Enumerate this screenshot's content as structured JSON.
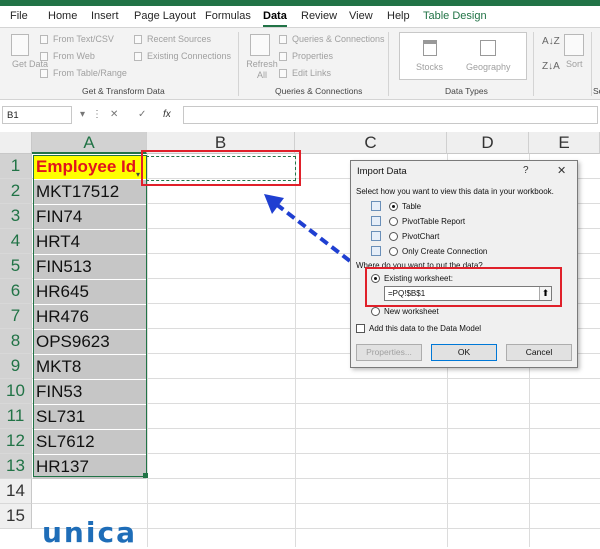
{
  "tabs": [
    "File",
    "Home",
    "Insert",
    "Page Layout",
    "Formulas",
    "Data",
    "Review",
    "View",
    "Help",
    "Table Design"
  ],
  "ribbon": {
    "get_data": "Get Data",
    "from_text_csv": "From Text/CSV",
    "from_web": "From Web",
    "from_table_range": "From Table/Range",
    "recent_sources": "Recent Sources",
    "existing_connections": "Existing Connections",
    "group_get_transform": "Get & Transform Data",
    "refresh_all": "Refresh All",
    "queries_connections": "Queries & Connections",
    "properties": "Properties",
    "edit_links": "Edit Links",
    "group_queries": "Queries & Connections",
    "stocks": "Stocks",
    "geography": "Geography",
    "group_data_types": "Data Types",
    "sort": "Sort",
    "group_partial": "So"
  },
  "formula_bar": {
    "name_box": "B1",
    "fx": "fx",
    "cancel": "✕",
    "enter": "✓"
  },
  "columns": [
    "A",
    "B",
    "C",
    "D",
    "E"
  ],
  "rows": [
    "1",
    "2",
    "3",
    "4",
    "5",
    "6",
    "7",
    "8",
    "9",
    "10",
    "11",
    "12",
    "13",
    "14",
    "15"
  ],
  "cells_a": [
    "Employee Id",
    "MKT17512",
    "FIN74",
    "HRT4",
    "FIN513",
    "HR645",
    "HR476",
    "OPS9623",
    "MKT8",
    "FIN53",
    "SL731",
    "SL7612",
    "HR137"
  ],
  "dialog": {
    "title": "Import Data",
    "help": "?",
    "close": "✕",
    "prompt": "Select how you want to view this data in your workbook.",
    "opt_table": "Table",
    "opt_pivot_table": "PivotTable Report",
    "opt_pivot_chart": "PivotChart",
    "opt_connection": "Only Create Connection",
    "where_prompt": "Where do you want to put the data?",
    "existing_ws": "Existing worksheet:",
    "ref_value": "=PQ!$B$1",
    "new_ws": "New worksheet",
    "add_model": "Add this data to the Data Model",
    "btn_properties": "Properties...",
    "btn_ok": "OK",
    "btn_cancel": "Cancel"
  },
  "logo": "unica",
  "colors": {
    "excel_green": "#217346",
    "highlight_red": "#e0202a",
    "header_yellow": "#ffff00",
    "arrow_blue": "#1f3fd1"
  }
}
